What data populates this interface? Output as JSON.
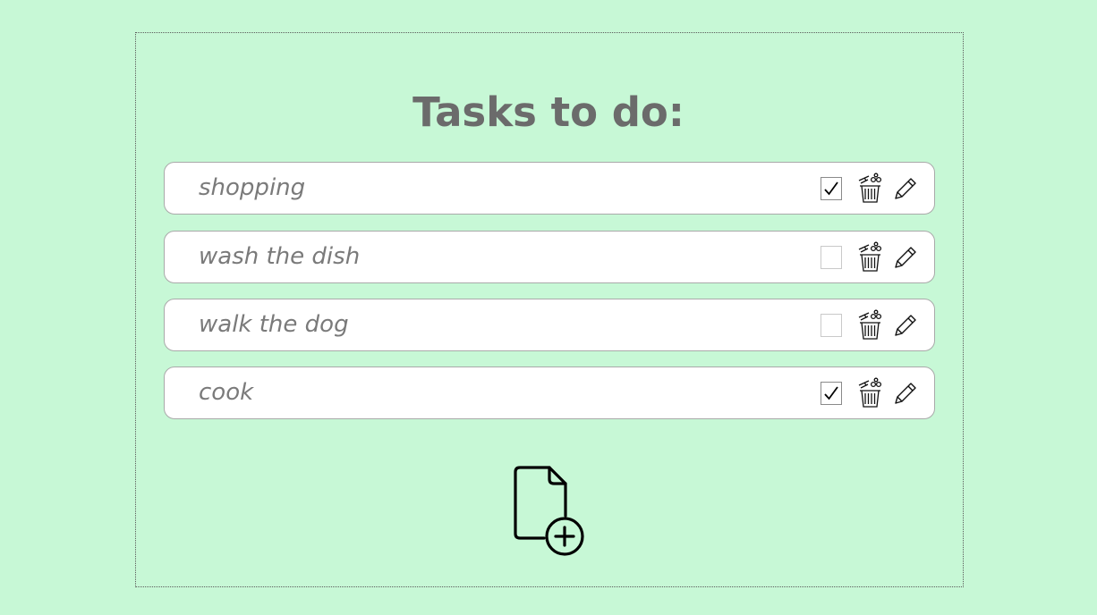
{
  "title": "Tasks to do:",
  "tasks": [
    {
      "label": "shopping",
      "done": true
    },
    {
      "label": "wash the dish",
      "done": false
    },
    {
      "label": "walk the dog",
      "done": false
    },
    {
      "label": "cook",
      "done": true
    }
  ],
  "icons": {
    "delete": "trash-icon",
    "edit": "pencil-icon",
    "add": "add-file-icon",
    "check": "checkmark-icon"
  },
  "colors": {
    "background": "#c7f8d6",
    "title": "#6b6b6b",
    "task_text": "#7a7a7a",
    "card": "#ffffff"
  }
}
